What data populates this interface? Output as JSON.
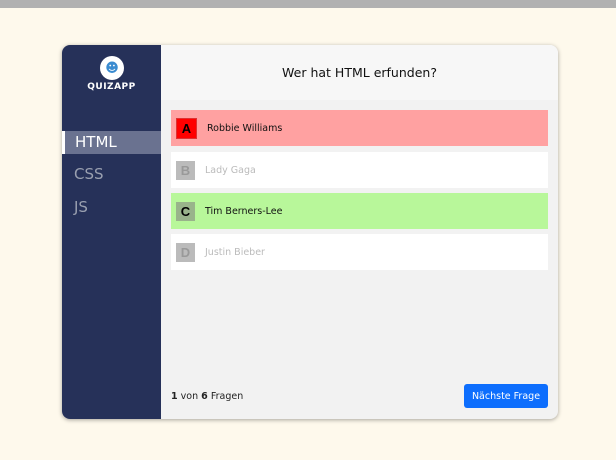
{
  "app": {
    "brand": "QUIZAPP"
  },
  "sidebar": {
    "items": [
      {
        "label": "HTML"
      },
      {
        "label": "CSS"
      },
      {
        "label": "JS"
      }
    ]
  },
  "question": "Wer hat HTML erfunden?",
  "answers": [
    {
      "letter": "A",
      "text": "Robbie Williams",
      "state": "wrong"
    },
    {
      "letter": "B",
      "text": "Lady Gaga",
      "state": "neutral"
    },
    {
      "letter": "C",
      "text": "Tim Berners-Lee",
      "state": "correct"
    },
    {
      "letter": "D",
      "text": "Justin Bieber",
      "state": "neutral"
    }
  ],
  "footer": {
    "current": "1",
    "von": "von",
    "total": "6",
    "fragen": "Fragen",
    "next_label": "Nächste Frage"
  },
  "colors": {
    "wrong": "#ffa1a1",
    "correct": "#b8f79a",
    "accent": "#0d6efd"
  }
}
